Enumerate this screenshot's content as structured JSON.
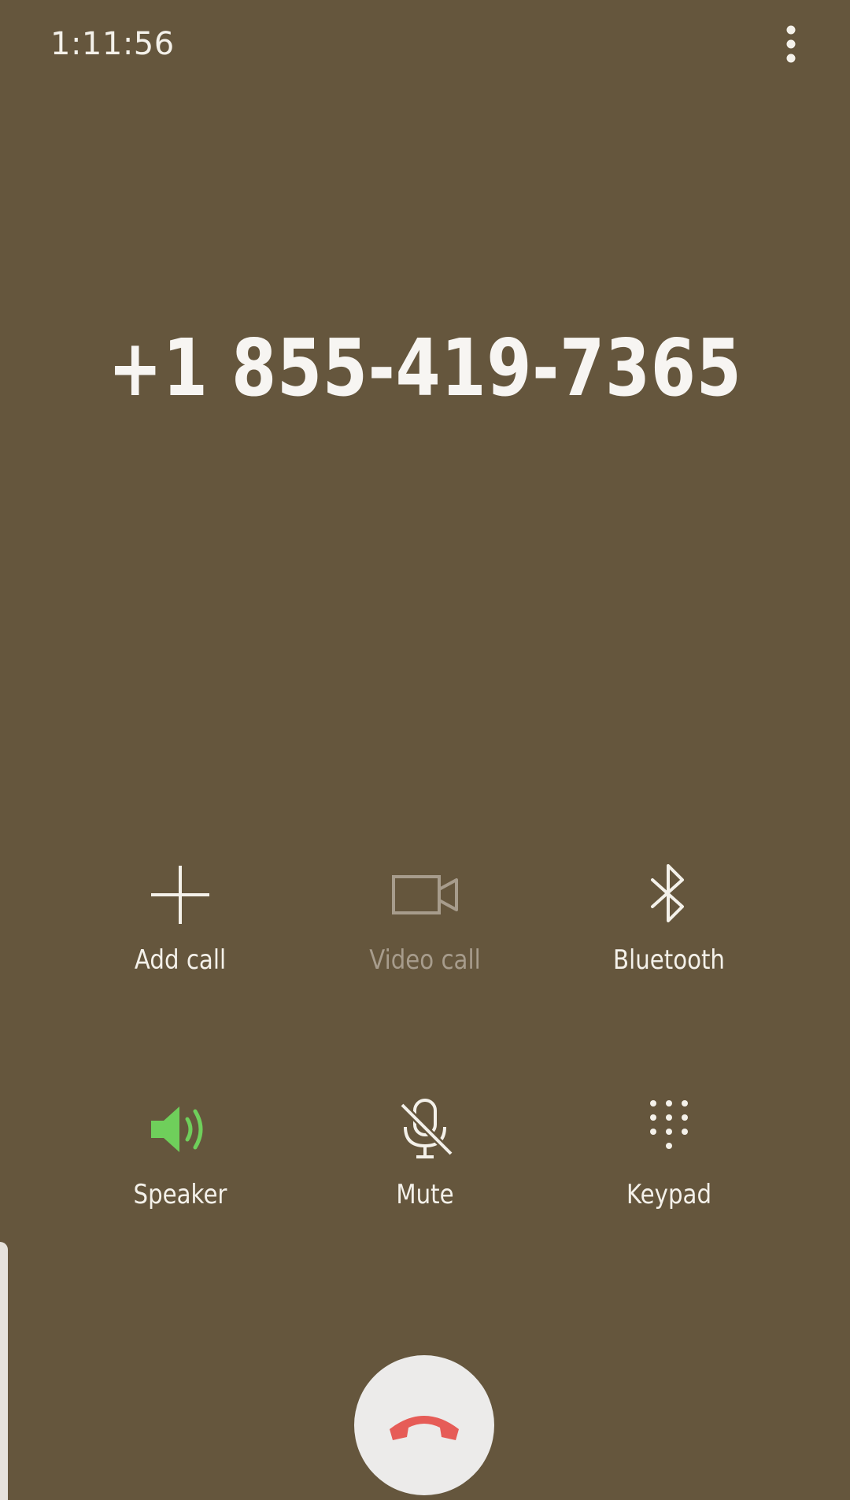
{
  "call": {
    "timer": "1:11:56",
    "number": "+1 855-419-7365"
  },
  "colors": {
    "background": "#65563d",
    "text": "#f4f1ea",
    "disabled": "#a79c8c",
    "speaker_active": "#6fcf5b",
    "end_call": "#e65c57",
    "end_button_bg": "#ecebea"
  },
  "actions": {
    "add_call": {
      "label": "Add call",
      "icon": "plus-icon"
    },
    "video_call": {
      "label": "Video call",
      "icon": "video-camera-icon",
      "enabled": false
    },
    "bluetooth": {
      "label": "Bluetooth",
      "icon": "bluetooth-icon"
    },
    "speaker": {
      "label": "Speaker",
      "icon": "speaker-icon",
      "active": true
    },
    "mute": {
      "label": "Mute",
      "icon": "microphone-off-icon"
    },
    "keypad": {
      "label": "Keypad",
      "icon": "keypad-icon"
    }
  },
  "controls": {
    "more_options_icon": "more-vertical-icon",
    "end_call_icon": "end-call-icon"
  }
}
